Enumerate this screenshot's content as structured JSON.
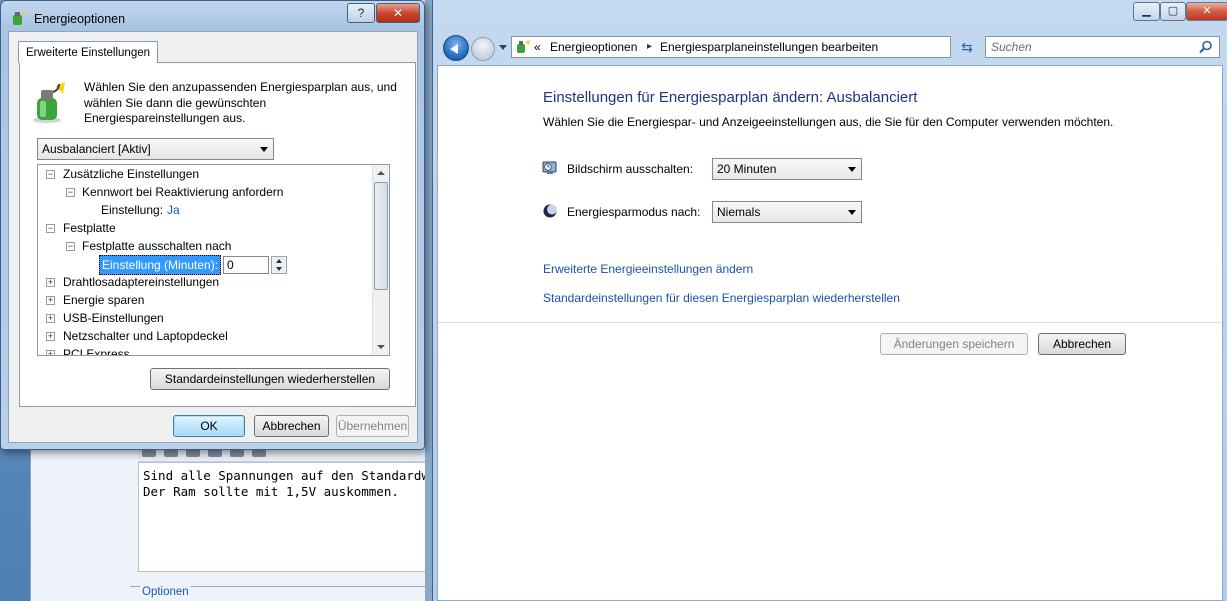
{
  "background": {
    "editor_lines": [
      "Sind alle Spannungen auf den Standardwert f",
      "Der Ram sollte mit 1,5V auskommen."
    ],
    "options_label": "Optionen"
  },
  "dialog": {
    "title": "Energieoptionen",
    "help_label": "?",
    "close_label": "✕",
    "tab_label": "Erweiterte Einstellungen",
    "description": "Wählen Sie den anzupassenden Energiesparplan aus, und wählen Sie dann die gewünschten Energiespareinstellungen aus.",
    "plan_selected": "Ausbalanciert [Aktiv]",
    "tree": {
      "item_zusaetzlich": "Zusätzliche Einstellungen",
      "item_kennwort": "Kennwort bei Reaktivierung anfordern",
      "kennwort_setting_label": "Einstellung:",
      "kennwort_setting_value": "Ja",
      "item_festplatte": "Festplatte",
      "item_festplatte_aus": "Festplatte ausschalten nach",
      "festplatte_setting_label": "Einstellung (Minuten):",
      "festplatte_setting_value": "0",
      "item_drahtlos": "Drahtlosadaptereinstellungen",
      "item_energie": "Energie sparen",
      "item_usb": "USB-Einstellungen",
      "item_netzschalter": "Netzschalter und Laptopdeckel",
      "item_pci": "PCI Express",
      "expanded_glyph": "−",
      "collapsed_glyph": "+"
    },
    "restore_button": "Standardeinstellungen wiederherstellen",
    "ok_button": "OK",
    "cancel_button": "Abbrechen",
    "apply_button": "Übernehmen"
  },
  "control_panel": {
    "caption": {
      "minimize": "▁",
      "maximize": "▢",
      "close": "✕"
    },
    "address": {
      "prefix": "«",
      "crumb_1": "Energieoptionen",
      "separator": "▸",
      "crumb_2": "Energiesparplaneinstellungen bearbeiten"
    },
    "refresh_glyph": "⇆",
    "search_placeholder": "Suchen",
    "heading": "Einstellungen für Energiesparplan ändern: Ausbalanciert",
    "subheading": "Wählen Sie die Energiespar- und Anzeigeeinstellungen aus, die Sie für den Computer verwenden möchten.",
    "display_off_label": "Bildschirm ausschalten:",
    "display_off_value": "20 Minuten",
    "sleep_label": "Energiesparmodus nach:",
    "sleep_value": "Niemals",
    "link_advanced": "Erweiterte Energieeinstellungen ändern",
    "link_restore": "Standardeinstellungen für diesen Energiesparplan wiederherstellen",
    "save_button": "Änderungen speichern",
    "cancel_button": "Abbrechen"
  },
  "colors": {
    "link": "#1a52a9",
    "heading": "#1e3287",
    "selection": "#3399ff"
  }
}
